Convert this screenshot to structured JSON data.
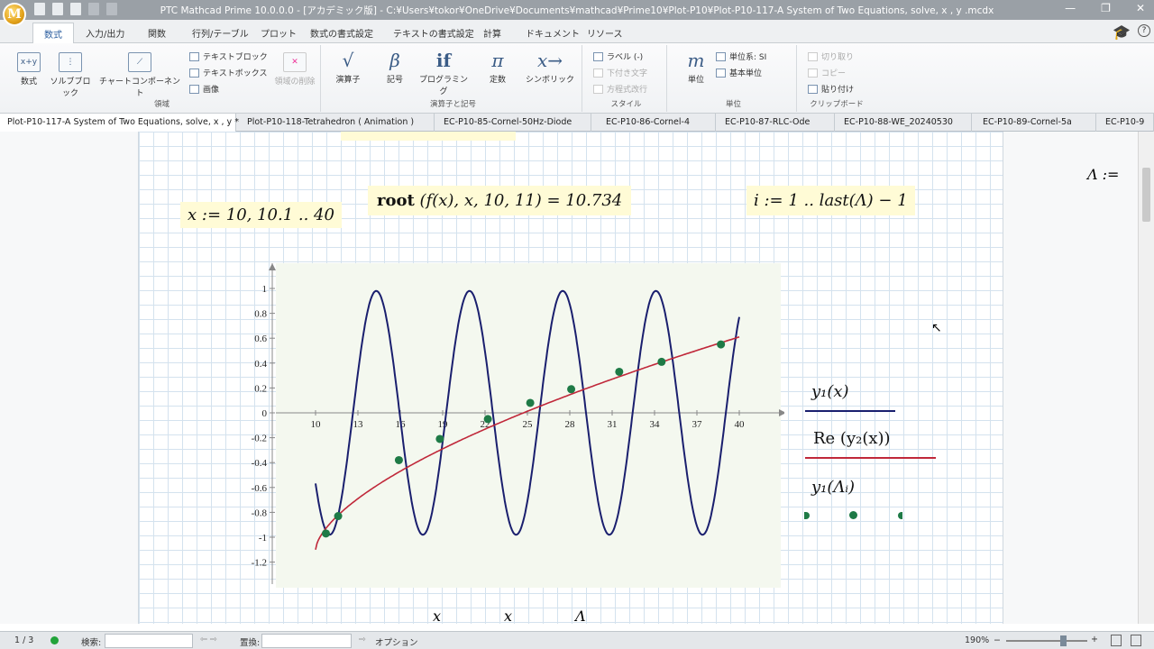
{
  "window": {
    "title": "PTC Mathcad Prime 10.0.0.0 - [アカデミック版] - C:¥Users¥tokor¥OneDrive¥Documents¥mathcad¥Prime10¥Plot-P10¥Plot-P10-117-A System of Two Equations, solve, x , y .mcdx",
    "logo_letter": "M",
    "minimize": "—",
    "restore": "❐",
    "close": "✕"
  },
  "menu_tabs": [
    "数式",
    "入力/出力",
    "関数",
    "行列/テーブル",
    "プロット",
    "数式の書式設定",
    "テキストの書式設定",
    "計算",
    "ドキュメント",
    "リソース"
  ],
  "help": "?",
  "ribbon": {
    "region_group": {
      "label": "領域",
      "math": "数式",
      "solve_block": "ソルブブロック",
      "chart": "チャートコンポーネント",
      "text_block": "テキストブロック",
      "text_box": "テキストボックス",
      "image": "画像",
      "delete_region": "領域の削除"
    },
    "operators_group": {
      "label": "演算子と記号",
      "operators": "演算子",
      "symbols": "記号",
      "programming": "プログラミング",
      "constants": "定数",
      "symbolic": "シンボリック"
    },
    "style_group": {
      "label": "スタイル",
      "label_btn": "ラベル (-)",
      "subscript": "下付き文字",
      "equation_wrap": "方程式改行"
    },
    "units_group": {
      "label": "単位",
      "units": "単位",
      "unit_system": "単位系: SI",
      "base_units": "基本単位"
    },
    "clipboard_group": {
      "label": "クリップボード",
      "cut": "切り取り",
      "copy": "コピー",
      "paste": "貼り付け"
    }
  },
  "doc_tabs": [
    "Plot-P10-117-A System of Two Equations, solve, x , y *",
    "Plot-P10-118-Tetrahedron ( Animation )",
    "EC-P10-85-Cornel-50Hz-Diode",
    "EC-P10-86-Cornel-4",
    "EC-P10-87-RLC-Ode",
    "EC-P10-88-WE_20240530",
    "EC-P10-89-Cornel-5a",
    "EC-P10-9"
  ],
  "worksheet": {
    "range_def": "x := 10, 10.1 .. 40",
    "root_fn": "root",
    "root_args": "(f(x), x, 10, 11) = 10.734",
    "index_def": "i := 1 .. last(Λ) − 1",
    "lambda_def": "Λ :=",
    "axis_bottom": [
      "x",
      "x",
      "Λ"
    ],
    "legend": {
      "y1": "y₁(x)",
      "y2": "Re (y₂(x))",
      "pts": "y₁(Λᵢ)"
    }
  },
  "status": {
    "page": "1 / 3",
    "search_label": "検索:",
    "replace_label": "置換:",
    "options": "オプション",
    "zoom": "190%"
  },
  "chart_data": {
    "type": "line",
    "x_ticks": [
      10,
      13,
      16,
      19,
      22,
      25,
      28,
      31,
      34,
      37,
      40
    ],
    "y_ticks": [
      1,
      0.8,
      0.6,
      0.4,
      0.2,
      0,
      -0.2,
      -0.4,
      -0.6,
      -0.8,
      -1,
      -1.2
    ],
    "xlim": [
      10,
      40
    ],
    "ylim": [
      -1.2,
      1
    ],
    "series": [
      {
        "name": "y₁(x)",
        "color": "#1a1f6e",
        "kind": "sine",
        "amplitude": 1,
        "period": 6.6,
        "phase_x": 10.0,
        "x_range": [
          10,
          40
        ]
      },
      {
        "name": "Re (y₂(x))",
        "color": "#c0283a",
        "kind": "sqrt",
        "x0": 10,
        "y0": -1.1,
        "x1": 40,
        "y1": 0.61,
        "x_range": [
          10,
          40
        ]
      }
    ],
    "points": [
      {
        "x": 10.734,
        "y": -0.97
      },
      {
        "x": 11.6,
        "y": -0.83
      },
      {
        "x": 15.9,
        "y": -0.38
      },
      {
        "x": 18.8,
        "y": -0.21
      },
      {
        "x": 22.2,
        "y": -0.05
      },
      {
        "x": 25.2,
        "y": 0.08
      },
      {
        "x": 28.1,
        "y": 0.19
      },
      {
        "x": 31.5,
        "y": 0.33
      },
      {
        "x": 34.5,
        "y": 0.41
      },
      {
        "x": 38.7,
        "y": 0.55
      }
    ],
    "point_color": "#1e7a46"
  }
}
